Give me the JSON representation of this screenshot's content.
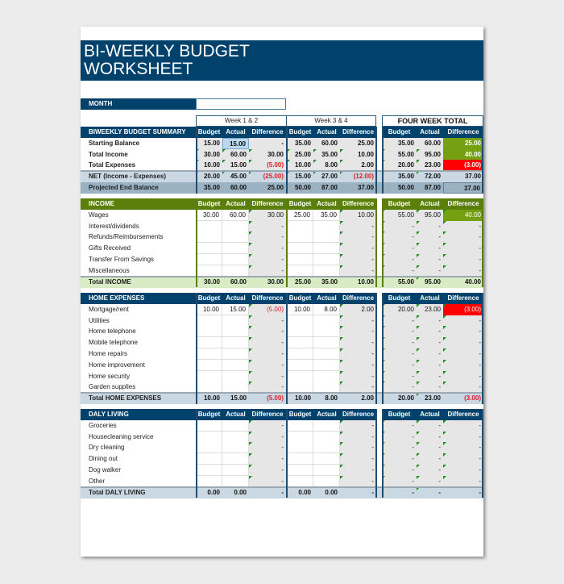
{
  "title": {
    "line1": "BI-WEEKLY BUDGET",
    "line2": "WORKSHEET"
  },
  "month": {
    "label": "MONTH",
    "value": ""
  },
  "periods": {
    "week12": "Week 1 & 2",
    "week34": "Week 3 & 4",
    "four_week": "FOUR WEEK TOTAL"
  },
  "col_headers": {
    "budget": "Budget",
    "actual": "Actual",
    "difference": "Difference"
  },
  "colors": {
    "navy": "#00426c",
    "green": "#5a7f0a",
    "light_green": "#d8ecc4",
    "light_blue": "#c9d8e2",
    "steel_blue": "#9ab2c2",
    "positive_fill": "#75a012",
    "negative_fill": "#ff0000",
    "negative_text": "#e31b23"
  },
  "summary": {
    "title": "BIWEEKLY BUDGET SUMMARY",
    "rows": [
      {
        "label": "Starting Balance",
        "w12": [
          "15.00",
          "15.00",
          "-"
        ],
        "w34": [
          "35.00",
          "60.00",
          "25.00"
        ],
        "fw": [
          "35.00",
          "60.00",
          "25.00"
        ]
      },
      {
        "label": "Total Income",
        "w12": [
          "30.00",
          "60.00",
          "30.00"
        ],
        "w34": [
          "25.00",
          "35.00",
          "10.00"
        ],
        "fw": [
          "55.00",
          "95.00",
          "40.00"
        ]
      },
      {
        "label": "Total Expenses",
        "w12": [
          "10.00",
          "15.00",
          "(5.00)"
        ],
        "w34": [
          "10.00",
          "8.00",
          "2.00"
        ],
        "fw": [
          "20.00",
          "23.00",
          "(3.00)"
        ]
      },
      {
        "label": "NET (Income - Expenses)",
        "w12": [
          "20.00",
          "45.00",
          "(25.00)"
        ],
        "w34": [
          "15.00",
          "27.00",
          "(12.00)"
        ],
        "fw": [
          "35.00",
          "72.00",
          "37.00"
        ]
      },
      {
        "label": "Projected End Balance",
        "w12": [
          "35.00",
          "60.00",
          "25.00"
        ],
        "w34": [
          "50.00",
          "87.00",
          "37.00"
        ],
        "fw": [
          "50.00",
          "87.00",
          "37.00"
        ]
      }
    ]
  },
  "income": {
    "title": "INCOME",
    "rows": [
      {
        "label": "Wages",
        "w12": [
          "30.00",
          "60.00",
          "30.00"
        ],
        "w34": [
          "25.00",
          "35.00",
          "10.00"
        ],
        "fw": [
          "55.00",
          "95.00",
          "40.00"
        ]
      },
      {
        "label": "Interest/dividends",
        "w12": [
          "",
          "",
          "-"
        ],
        "w34": [
          "",
          "",
          "-"
        ],
        "fw": [
          "-",
          "-",
          "-"
        ]
      },
      {
        "label": "Refunds/Reimbursements",
        "w12": [
          "",
          "",
          "-"
        ],
        "w34": [
          "",
          "",
          "-"
        ],
        "fw": [
          "-",
          "-",
          "-"
        ]
      },
      {
        "label": "Gifts Received",
        "w12": [
          "",
          "",
          "-"
        ],
        "w34": [
          "",
          "",
          "-"
        ],
        "fw": [
          "-",
          "-",
          "-"
        ]
      },
      {
        "label": "Transfer From Savings",
        "w12": [
          "",
          "",
          "-"
        ],
        "w34": [
          "",
          "",
          "-"
        ],
        "fw": [
          "-",
          "-",
          "-"
        ]
      },
      {
        "label": "Miscellaneous",
        "w12": [
          "",
          "",
          "-"
        ],
        "w34": [
          "",
          "",
          "-"
        ],
        "fw": [
          "-",
          "-",
          "-"
        ]
      }
    ],
    "total": {
      "label": "Total INCOME",
      "w12": [
        "30.00",
        "60.00",
        "30.00"
      ],
      "w34": [
        "25.00",
        "35.00",
        "10.00"
      ],
      "fw": [
        "55.00",
        "95.00",
        "40.00"
      ]
    }
  },
  "home": {
    "title": "HOME EXPENSES",
    "rows": [
      {
        "label": "Mortgage/rent",
        "w12": [
          "10.00",
          "15.00",
          "(5.00)"
        ],
        "w34": [
          "10.00",
          "8.00",
          "2.00"
        ],
        "fw": [
          "20.00",
          "23.00",
          "(3.00)"
        ]
      },
      {
        "label": "Utilities",
        "w12": [
          "",
          "",
          "-"
        ],
        "w34": [
          "",
          "",
          "-"
        ],
        "fw": [
          "-",
          "-",
          "-"
        ]
      },
      {
        "label": "Home telephone",
        "w12": [
          "",
          "",
          "-"
        ],
        "w34": [
          "",
          "",
          "-"
        ],
        "fw": [
          "-",
          "-",
          "-"
        ]
      },
      {
        "label": "Mobile telephone",
        "w12": [
          "",
          "",
          "-"
        ],
        "w34": [
          "",
          "",
          "-"
        ],
        "fw": [
          "-",
          "-",
          "-"
        ]
      },
      {
        "label": "Home repairs",
        "w12": [
          "",
          "",
          "-"
        ],
        "w34": [
          "",
          "",
          "-"
        ],
        "fw": [
          "-",
          "-",
          "-"
        ]
      },
      {
        "label": "Home improvement",
        "w12": [
          "",
          "",
          "-"
        ],
        "w34": [
          "",
          "",
          "-"
        ],
        "fw": [
          "-",
          "-",
          "-"
        ]
      },
      {
        "label": "Home security",
        "w12": [
          "",
          "",
          "-"
        ],
        "w34": [
          "",
          "",
          "-"
        ],
        "fw": [
          "-",
          "-",
          "-"
        ]
      },
      {
        "label": "Garden supplies",
        "w12": [
          "",
          "",
          "-"
        ],
        "w34": [
          "",
          "",
          "-"
        ],
        "fw": [
          "-",
          "-",
          "-"
        ]
      }
    ],
    "total": {
      "label": "Total HOME EXPENSES",
      "w12": [
        "10.00",
        "15.00",
        "(5.00)"
      ],
      "w34": [
        "10.00",
        "8.00",
        "2.00"
      ],
      "fw": [
        "20.00",
        "23.00",
        "(3.00)"
      ]
    }
  },
  "daily": {
    "title": "DALY LIVING",
    "rows": [
      {
        "label": "Groceries",
        "w12": [
          "",
          "",
          "-"
        ],
        "w34": [
          "",
          "",
          "-"
        ],
        "fw": [
          "-",
          "-",
          "-"
        ]
      },
      {
        "label": "Housecleaning service",
        "w12": [
          "",
          "",
          "-"
        ],
        "w34": [
          "",
          "",
          "-"
        ],
        "fw": [
          "-",
          "-",
          "-"
        ]
      },
      {
        "label": "Dry cleaning",
        "w12": [
          "",
          "",
          "-"
        ],
        "w34": [
          "",
          "",
          "-"
        ],
        "fw": [
          "-",
          "-",
          "-"
        ]
      },
      {
        "label": "Dining out",
        "w12": [
          "",
          "",
          "-"
        ],
        "w34": [
          "",
          "",
          "-"
        ],
        "fw": [
          "-",
          "-",
          "-"
        ]
      },
      {
        "label": "Dog walker",
        "w12": [
          "",
          "",
          "-"
        ],
        "w34": [
          "",
          "",
          "-"
        ],
        "fw": [
          "-",
          "-",
          "-"
        ]
      },
      {
        "label": "Other",
        "w12": [
          "",
          "",
          "-"
        ],
        "w34": [
          "",
          "",
          "-"
        ],
        "fw": [
          "-",
          "-",
          "-"
        ]
      }
    ],
    "total": {
      "label": "Total DALY LIVING",
      "w12": [
        "0.00",
        "0.00",
        "-"
      ],
      "w34": [
        "0.00",
        "0.00",
        "-"
      ],
      "fw": [
        "-",
        "-",
        "-"
      ]
    }
  }
}
